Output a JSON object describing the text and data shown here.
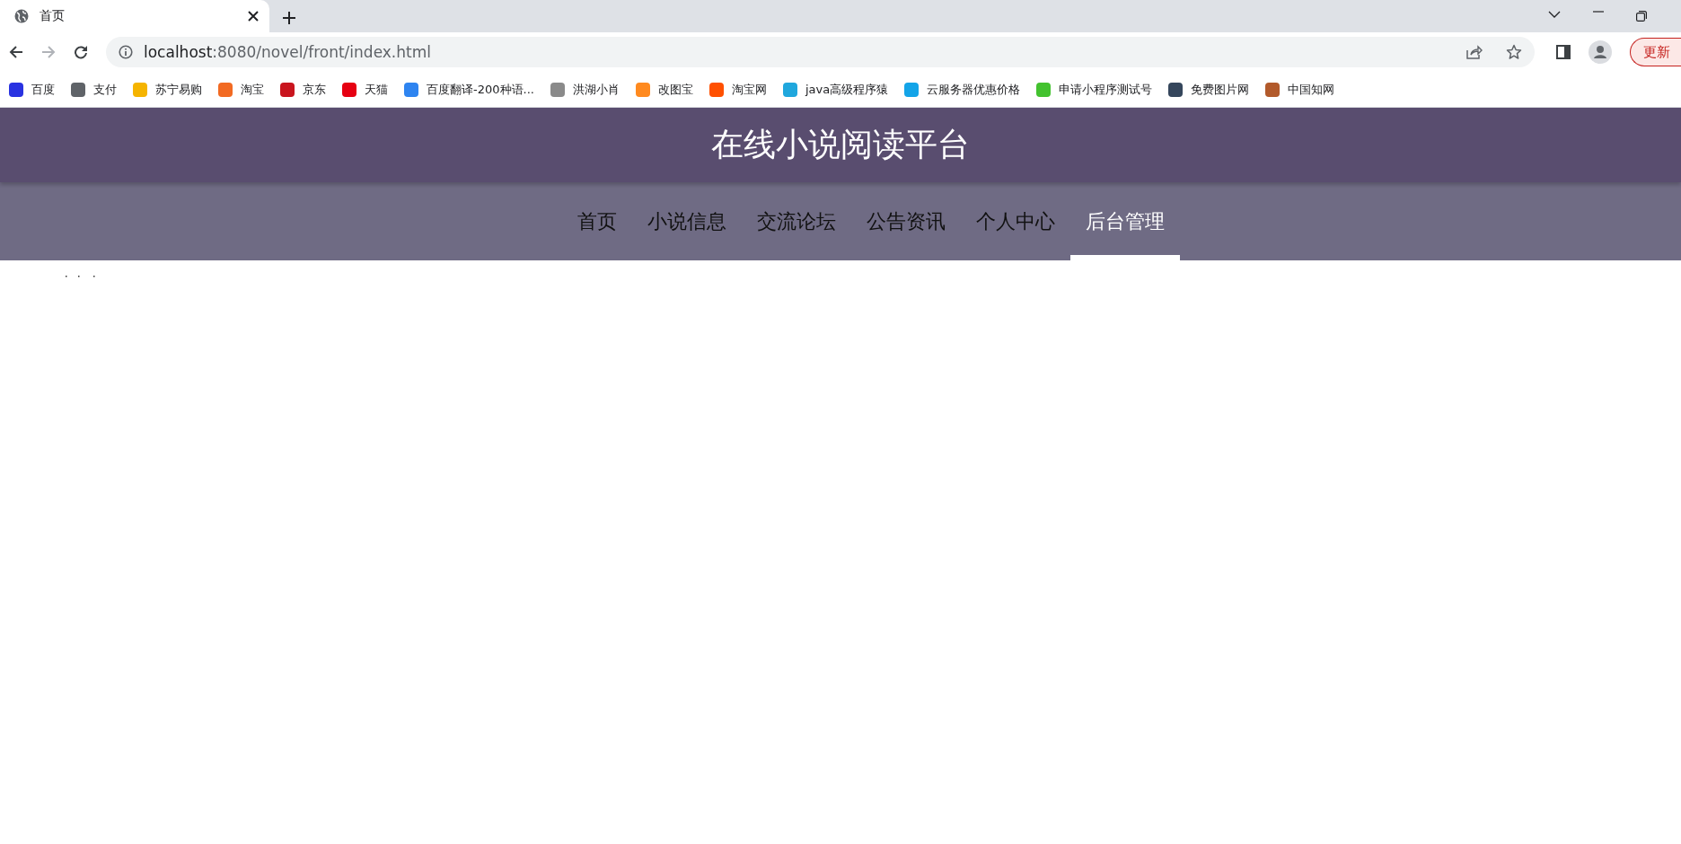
{
  "browser": {
    "tab": {
      "title": "首页"
    },
    "address": {
      "host": "localhost",
      "path": ":8080/novel/front/index.html"
    },
    "update_button": "更新",
    "bookmarks": [
      {
        "label": "百度",
        "color": "#2932e1"
      },
      {
        "label": "支付",
        "color": "#5f6368"
      },
      {
        "label": "苏宁易购",
        "color": "#f5b400"
      },
      {
        "label": "淘宝",
        "color": "#f26a22"
      },
      {
        "label": "京东",
        "color": "#c9151e"
      },
      {
        "label": "天猫",
        "color": "#e60012"
      },
      {
        "label": "百度翻译-200种语...",
        "color": "#2e84f0"
      },
      {
        "label": "洪湖小肖",
        "color": "#8a8a8a"
      },
      {
        "label": "改图宝",
        "color": "#ff8a1f"
      },
      {
        "label": "淘宝网",
        "color": "#ff5000"
      },
      {
        "label": "java高级程序猿",
        "color": "#20a7dd"
      },
      {
        "label": "云服务器优惠价格",
        "color": "#13a4e8"
      },
      {
        "label": "申请小程序测试号",
        "color": "#43c22f"
      },
      {
        "label": "免费图片网",
        "color": "#35465c"
      },
      {
        "label": "中国知网",
        "color": "#b25a2b"
      }
    ]
  },
  "site": {
    "title": "在线小说阅读平台",
    "nav": [
      {
        "label": "首页",
        "selected": false
      },
      {
        "label": "小说信息",
        "selected": false
      },
      {
        "label": "交流论坛",
        "selected": false
      },
      {
        "label": "公告资讯",
        "selected": false
      },
      {
        "label": "个人中心",
        "selected": false
      },
      {
        "label": "后台管理",
        "selected": true
      }
    ]
  }
}
